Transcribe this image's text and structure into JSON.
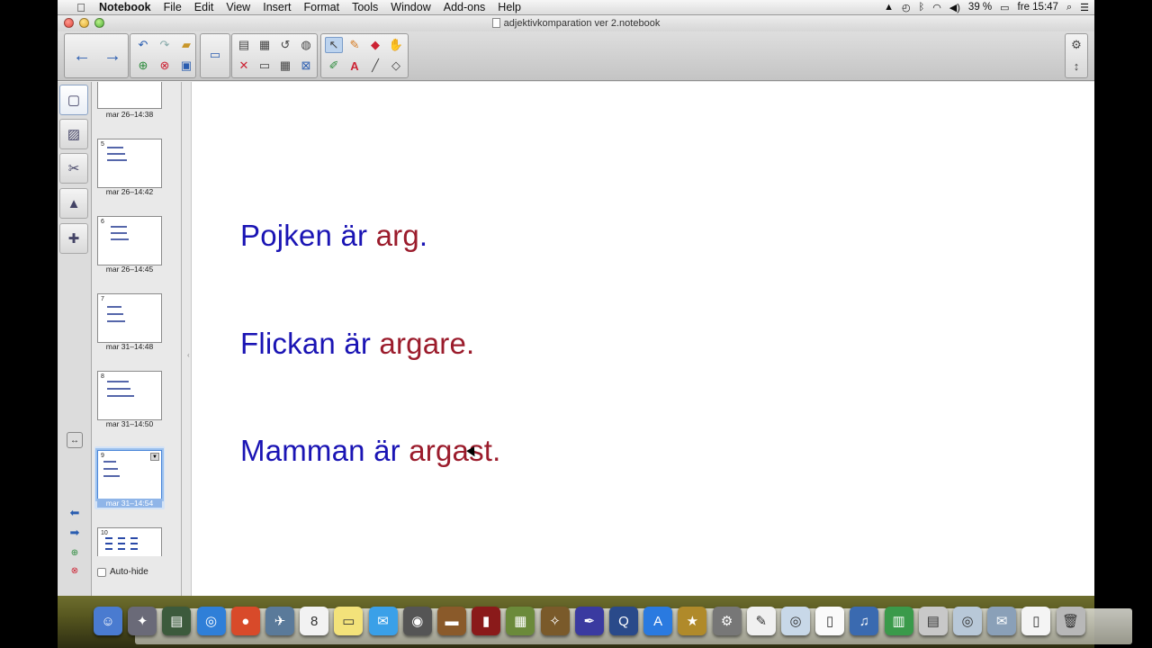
{
  "menubar": {
    "apple": "",
    "items": [
      "Notebook",
      "File",
      "Edit",
      "View",
      "Insert",
      "Format",
      "Tools",
      "Window",
      "Add-ons",
      "Help"
    ],
    "battery": "39 %",
    "clock": "fre 15:47"
  },
  "window": {
    "title": "adjektivkomparation ver 2.notebook"
  },
  "sorter": {
    "pages": [
      {
        "number": "",
        "label": "mar 26–14:38"
      },
      {
        "number": "5",
        "label": "mar 26–14:42"
      },
      {
        "number": "6",
        "label": "mar 26–14:45"
      },
      {
        "number": "7",
        "label": "mar 31–14:48"
      },
      {
        "number": "8",
        "label": "mar 31–14:50"
      },
      {
        "number": "9",
        "label": "mar 31–14:54"
      },
      {
        "number": "10",
        "label": ""
      }
    ],
    "autohide_label": "Auto-hide"
  },
  "canvas": {
    "sentences": [
      {
        "subject": "Pojken är ",
        "adjective": "arg",
        "end": "."
      },
      {
        "subject": "Flickan är ",
        "adjective": "argare",
        "end": "."
      },
      {
        "subject": "Mamman är ",
        "adjective": "argast",
        "end": "."
      }
    ]
  },
  "colors": {
    "subject_text": "#1a14b4",
    "adjective_text": "#9b1c2c",
    "selection": "#8fb5e8"
  },
  "icons": {
    "toolbar": [
      "back-arrow-icon",
      "forward-arrow-icon",
      "undo-icon",
      "redo-icon",
      "open-folder-icon",
      "blank-page-icon",
      "delete-page-icon",
      "save-icon",
      "screen-display-icon",
      "paste-icon",
      "screen-capture-icon",
      "clear-page-icon",
      "screen-shade-icon",
      "table-icon",
      "delete-icon",
      "select-icon",
      "pen-icon",
      "eraser-icon",
      "magic-pen-icon",
      "creative-pen-icon",
      "text-icon",
      "line-icon",
      "fill-icon",
      "settings-gear-icon",
      "move-toolbar-icon"
    ],
    "sidebar": [
      "page-sorter-icon",
      "gallery-icon",
      "attachments-icon",
      "properties-icon",
      "addons-icon"
    ],
    "dock": [
      "finder-icon",
      "launchpad-icon",
      "system-utility-icon",
      "safari-icon",
      "chrome-icon",
      "preview-icon",
      "calendar-icon",
      "stickies-icon",
      "messages-icon",
      "facetime-icon",
      "keynote-icon",
      "photo-booth-icon",
      "iphoto-icon",
      "garageband-icon",
      "pen-app-icon",
      "quicktime-icon",
      "app-store-icon",
      "imovie-icon",
      "system-preferences-icon",
      "textedit-icon",
      "dvd-icon",
      "document-icon",
      "itunes-icon",
      "numbers-icon",
      "printer-icon",
      "disk-utility-icon",
      "photos-icon",
      "file-icon",
      "trash-icon"
    ]
  }
}
